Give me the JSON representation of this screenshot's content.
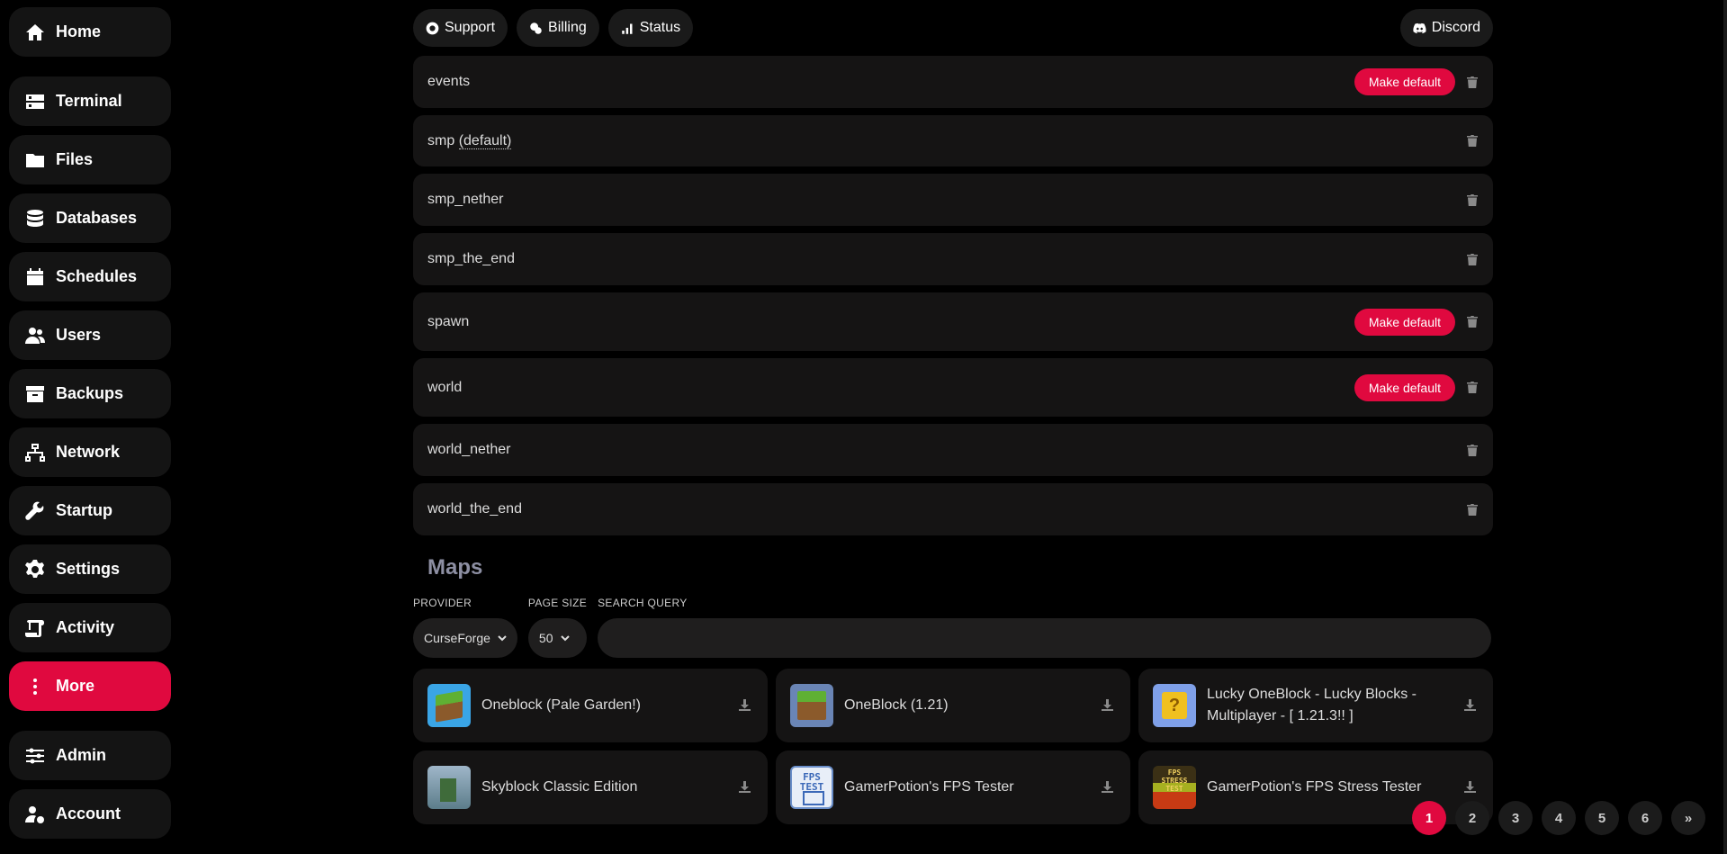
{
  "sidebar": {
    "items": [
      {
        "label": "Home",
        "icon": "home-icon"
      },
      {
        "label": "Terminal",
        "icon": "terminal-icon"
      },
      {
        "label": "Files",
        "icon": "folder-icon"
      },
      {
        "label": "Databases",
        "icon": "database-icon"
      },
      {
        "label": "Schedules",
        "icon": "calendar-icon"
      },
      {
        "label": "Users",
        "icon": "users-icon"
      },
      {
        "label": "Backups",
        "icon": "archive-icon"
      },
      {
        "label": "Network",
        "icon": "network-icon"
      },
      {
        "label": "Startup",
        "icon": "wrench-icon"
      },
      {
        "label": "Settings",
        "icon": "gear-icon"
      },
      {
        "label": "Activity",
        "icon": "scroll-icon"
      },
      {
        "label": "More",
        "icon": "more-vertical-icon",
        "active": true
      },
      {
        "label": "Admin",
        "icon": "sliders-icon"
      },
      {
        "label": "Account",
        "icon": "user-gear-icon"
      }
    ]
  },
  "topbar": {
    "support": "Support",
    "billing": "Billing",
    "status": "Status",
    "discord": "Discord"
  },
  "worlds": [
    {
      "name": "events",
      "default_marker": "",
      "make_default": "Make default"
    },
    {
      "name": "smp",
      "default_marker": "(default)",
      "make_default": ""
    },
    {
      "name": "smp_nether",
      "default_marker": "",
      "make_default": ""
    },
    {
      "name": "smp_the_end",
      "default_marker": "",
      "make_default": ""
    },
    {
      "name": "spawn",
      "default_marker": "",
      "make_default": "Make default"
    },
    {
      "name": "world",
      "default_marker": "",
      "make_default": "Make default"
    },
    {
      "name": "world_nether",
      "default_marker": "",
      "make_default": ""
    },
    {
      "name": "world_the_end",
      "default_marker": "",
      "make_default": ""
    }
  ],
  "maps": {
    "title": "Maps",
    "provider_label": "PROVIDER",
    "provider_value": "CurseForge",
    "page_size_label": "PAGE SIZE",
    "page_size_value": "50",
    "search_label": "SEARCH QUERY",
    "search_value": "",
    "results": [
      {
        "title": "Oneblock (Pale Garden!)",
        "thumb": "grass"
      },
      {
        "title": "OneBlock (1.21)",
        "thumb": "grass2"
      },
      {
        "title": "Lucky OneBlock - Lucky Blocks - Multiplayer - [ 1.21.3!! ]",
        "thumb": "lucky"
      },
      {
        "title": "Skyblock Classic Edition",
        "thumb": "sky"
      },
      {
        "title": "GamerPotion's FPS Tester",
        "thumb": "fps",
        "thumb_text": "FPS\nTEST"
      },
      {
        "title": "GamerPotion's FPS Stress Tester",
        "thumb": "stress",
        "thumb_text": "FPS\nSTRESS\nTEST"
      }
    ]
  },
  "pagination": {
    "pages": [
      "1",
      "2",
      "3",
      "4",
      "5",
      "6"
    ],
    "current": "1",
    "next": "»"
  },
  "colors": {
    "accent": "#e0093f",
    "background": "#000000",
    "card": "#151414"
  }
}
